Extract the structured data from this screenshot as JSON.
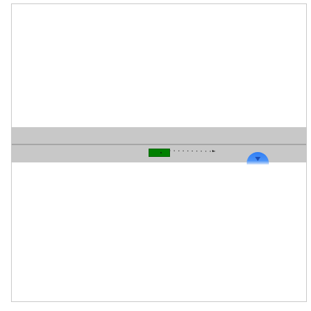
{
  "scene": {
    "icons": {
      "vehicle": "green-rectangle-vehicle",
      "trajectory": "dotted-arrow",
      "agent": "blue-half-disc-marker"
    },
    "colors": {
      "background": "#ffffff",
      "road": "#c8c8c8",
      "lane_divider": "#a6a6a6",
      "vehicle": "#008000",
      "agent": "#3b82f6"
    }
  }
}
